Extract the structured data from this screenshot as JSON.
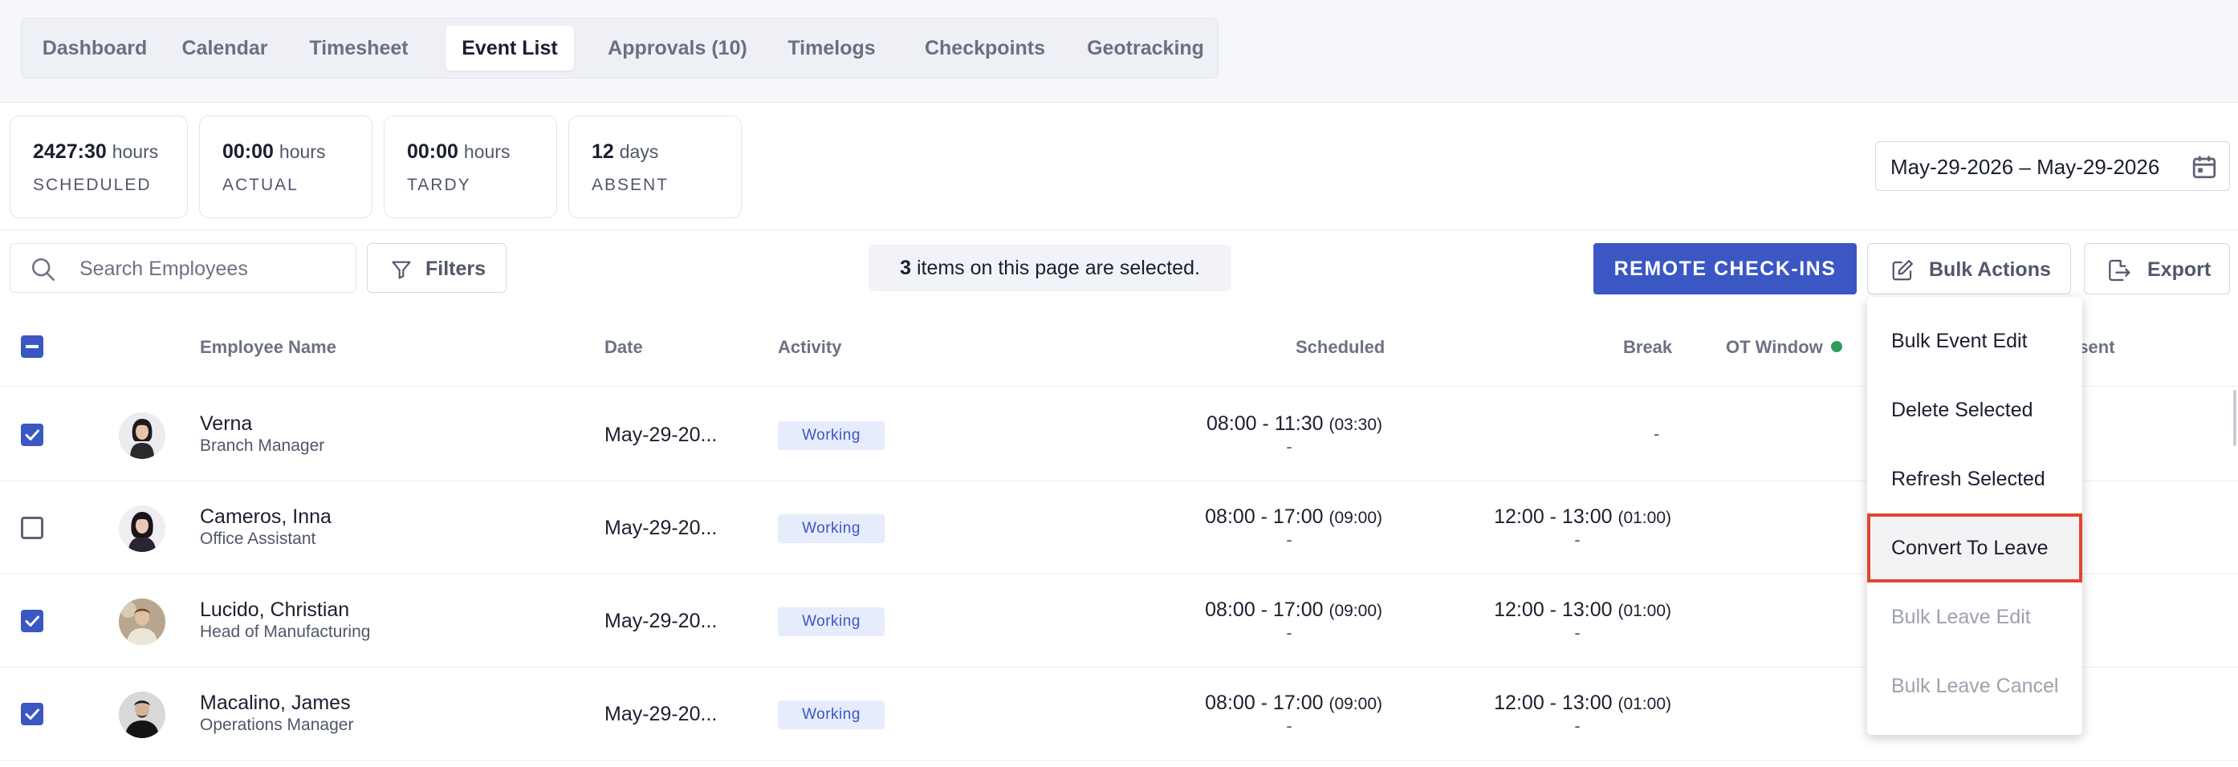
{
  "tabs": [
    {
      "label": "Dashboard"
    },
    {
      "label": "Calendar"
    },
    {
      "label": "Timesheet"
    },
    {
      "label": "Event List",
      "active": true
    },
    {
      "label": "Approvals (10)"
    },
    {
      "label": "Timelogs"
    },
    {
      "label": "Checkpoints"
    },
    {
      "label": "Geotracking"
    }
  ],
  "stats": [
    {
      "value": "2427:30",
      "unit": "hours",
      "label": "SCHEDULED"
    },
    {
      "value": "00:00",
      "unit": "hours",
      "label": "ACTUAL"
    },
    {
      "value": "00:00",
      "unit": "hours",
      "label": "TARDY"
    },
    {
      "value": "12",
      "unit": "days",
      "label": "ABSENT"
    }
  ],
  "date_range": {
    "value": "May-29-2026 – May-29-2026",
    "icon": "calendar-icon"
  },
  "toolbar": {
    "search_placeholder": "Search Employees",
    "filters_label": "Filters",
    "selection_count": "3",
    "selection_text": "items on this page are selected.",
    "remote_checkins_label": "REMOTE CHECK-INS",
    "bulk_actions_label": "Bulk Actions",
    "export_label": "Export"
  },
  "table": {
    "headers": {
      "employee_name": "Employee Name",
      "date": "Date",
      "activity": "Activity",
      "scheduled": "Scheduled",
      "break": "Break",
      "ot_window": "OT Window",
      "absent": "Absent"
    },
    "rows": [
      {
        "name": "Verna",
        "role": "Branch Manager",
        "date": "May-29-20...",
        "activity": "Working",
        "scheduled": "08:00 - 11:30",
        "scheduled_dur": "(03:30)",
        "scheduled_sub": "-",
        "break": "",
        "break_dur": "",
        "break_sub": "-",
        "checked": true
      },
      {
        "name": "Cameros, Inna",
        "role": "Office Assistant",
        "date": "May-29-20...",
        "activity": "Working",
        "scheduled": "08:00 - 17:00",
        "scheduled_dur": "(09:00)",
        "scheduled_sub": "-",
        "break": "12:00 - 13:00",
        "break_dur": "(01:00)",
        "break_sub": "-",
        "checked": false
      },
      {
        "name": "Lucido, Christian",
        "role": "Head of Manufacturing",
        "date": "May-29-20...",
        "activity": "Working",
        "scheduled": "08:00 - 17:00",
        "scheduled_dur": "(09:00)",
        "scheduled_sub": "-",
        "break": "12:00 - 13:00",
        "break_dur": "(01:00)",
        "break_sub": "-",
        "checked": true
      },
      {
        "name": "Macalino, James",
        "role": "Operations Manager",
        "date": "May-29-20...",
        "activity": "Working",
        "scheduled": "08:00 - 17:00",
        "scheduled_dur": "(09:00)",
        "scheduled_sub": "-",
        "break": "12:00 - 13:00",
        "break_dur": "(01:00)",
        "break_sub": "-",
        "checked": true
      }
    ]
  },
  "bulk_menu": {
    "items": [
      {
        "label": "Bulk Event Edit",
        "enabled": true
      },
      {
        "label": "Delete Selected",
        "enabled": true
      },
      {
        "label": "Refresh Selected",
        "enabled": true
      },
      {
        "label": "Convert To Leave",
        "enabled": true,
        "highlighted": true
      },
      {
        "label": "Bulk Leave Edit",
        "enabled": false
      },
      {
        "label": "Bulk Leave Cancel",
        "enabled": false
      }
    ]
  },
  "colors": {
    "primary": "#3a57c4",
    "highlight_border": "#e0452f",
    "ot_dot": "#2e9d5a",
    "badge_bg": "#e6ecfb"
  }
}
